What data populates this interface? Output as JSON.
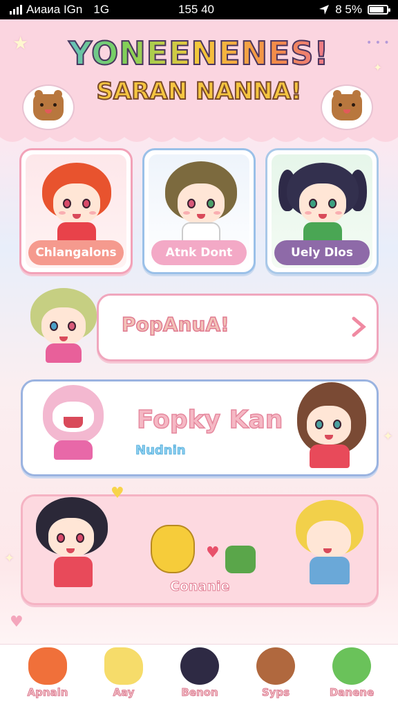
{
  "status_bar": {
    "carrier": "Aᴎaᴎa IGn",
    "network": "1G",
    "time": "155 40",
    "battery": "8 5%",
    "battery_level": 0.85
  },
  "header": {
    "title": "YONEENENES!",
    "subtitle": "SARAN NANNA!"
  },
  "cards": [
    {
      "label": "Chlangalons",
      "pill_color": "#f59a8e"
    },
    {
      "label": "Atnk Dont",
      "pill_color": "#f3a9c6"
    },
    {
      "label": "Uely Dlos",
      "pill_color": "#8e6aa8"
    }
  ],
  "banners": {
    "first": {
      "text": "PopAnuA!"
    },
    "second": {
      "title": "Fopky Kan",
      "subtitle": "Nudnin"
    },
    "third": {
      "label": "Conanie"
    }
  },
  "nav": {
    "items": [
      {
        "label": "Apnaln"
      },
      {
        "label": "Aay"
      },
      {
        "label": "Benon"
      },
      {
        "label": "Syps"
      },
      {
        "label": "Danene"
      }
    ]
  }
}
